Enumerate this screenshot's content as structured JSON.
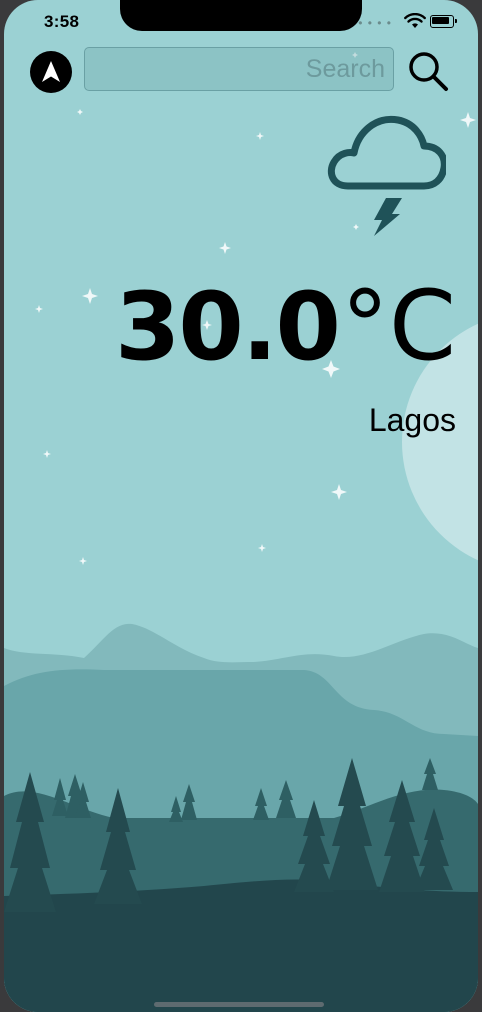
{
  "status_bar": {
    "time": "3:58",
    "signal_icon": "signal-dots-icon",
    "wifi_icon": "wifi-icon",
    "battery_icon": "battery-icon"
  },
  "toolbar": {
    "location_icon": "location-arrow-icon",
    "search_placeholder": "Search",
    "search_value": "",
    "search_icon": "magnifier-icon"
  },
  "weather": {
    "condition_icon": "cloud-lightning-icon",
    "temperature": "30.0",
    "unit": "°C",
    "city": "Lagos"
  },
  "colors": {
    "sky": "#9bd1d3",
    "moon": "#c2e3e5",
    "hill_back": "#82b9bc",
    "hill_mid": "#69a6aa",
    "hill_front": "#366a6e",
    "ground": "#22464c",
    "trees": "#244a4f"
  }
}
